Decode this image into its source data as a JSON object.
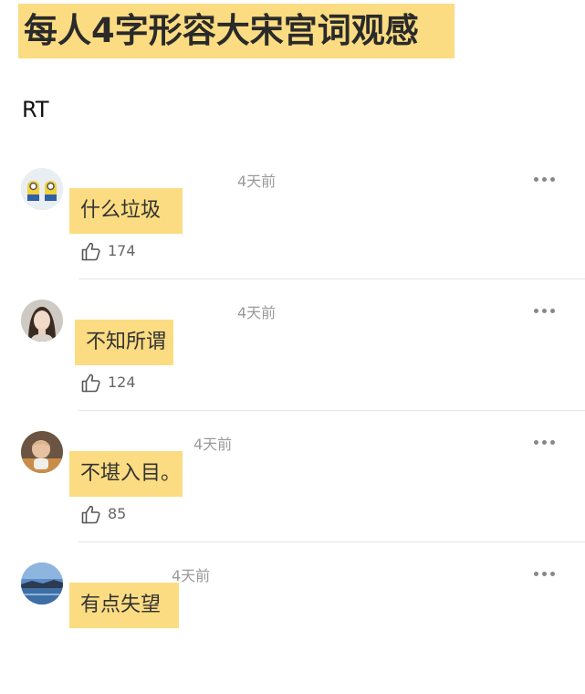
{
  "post": {
    "title": "每人4字形容大宋宫词观感",
    "body": "RT"
  },
  "comments": [
    {
      "time": "4天前",
      "text": "什么垃圾",
      "likes": "174",
      "avatar_icon": "minion-avatar",
      "avatar_color": "#f2d13b"
    },
    {
      "time": "4天前",
      "text": "不知所谓",
      "likes": "124",
      "avatar_icon": "woman-portrait-avatar",
      "avatar_color": "#c9c2bd"
    },
    {
      "time": "4天前",
      "text": "不堪入目。",
      "likes": "85",
      "avatar_icon": "child-photo-avatar",
      "avatar_color": "#8a6a4e"
    },
    {
      "time": "4天前",
      "text": "有点失望",
      "likes": "",
      "avatar_icon": "landscape-avatar",
      "avatar_color": "#3f6fa8"
    }
  ],
  "colors": {
    "highlight": "#fbdc82",
    "time_text": "#9a9a9a",
    "divider": "#e6e6e6"
  },
  "icons": {
    "like": "thumbs-up-icon",
    "more": "more-dots-icon"
  }
}
